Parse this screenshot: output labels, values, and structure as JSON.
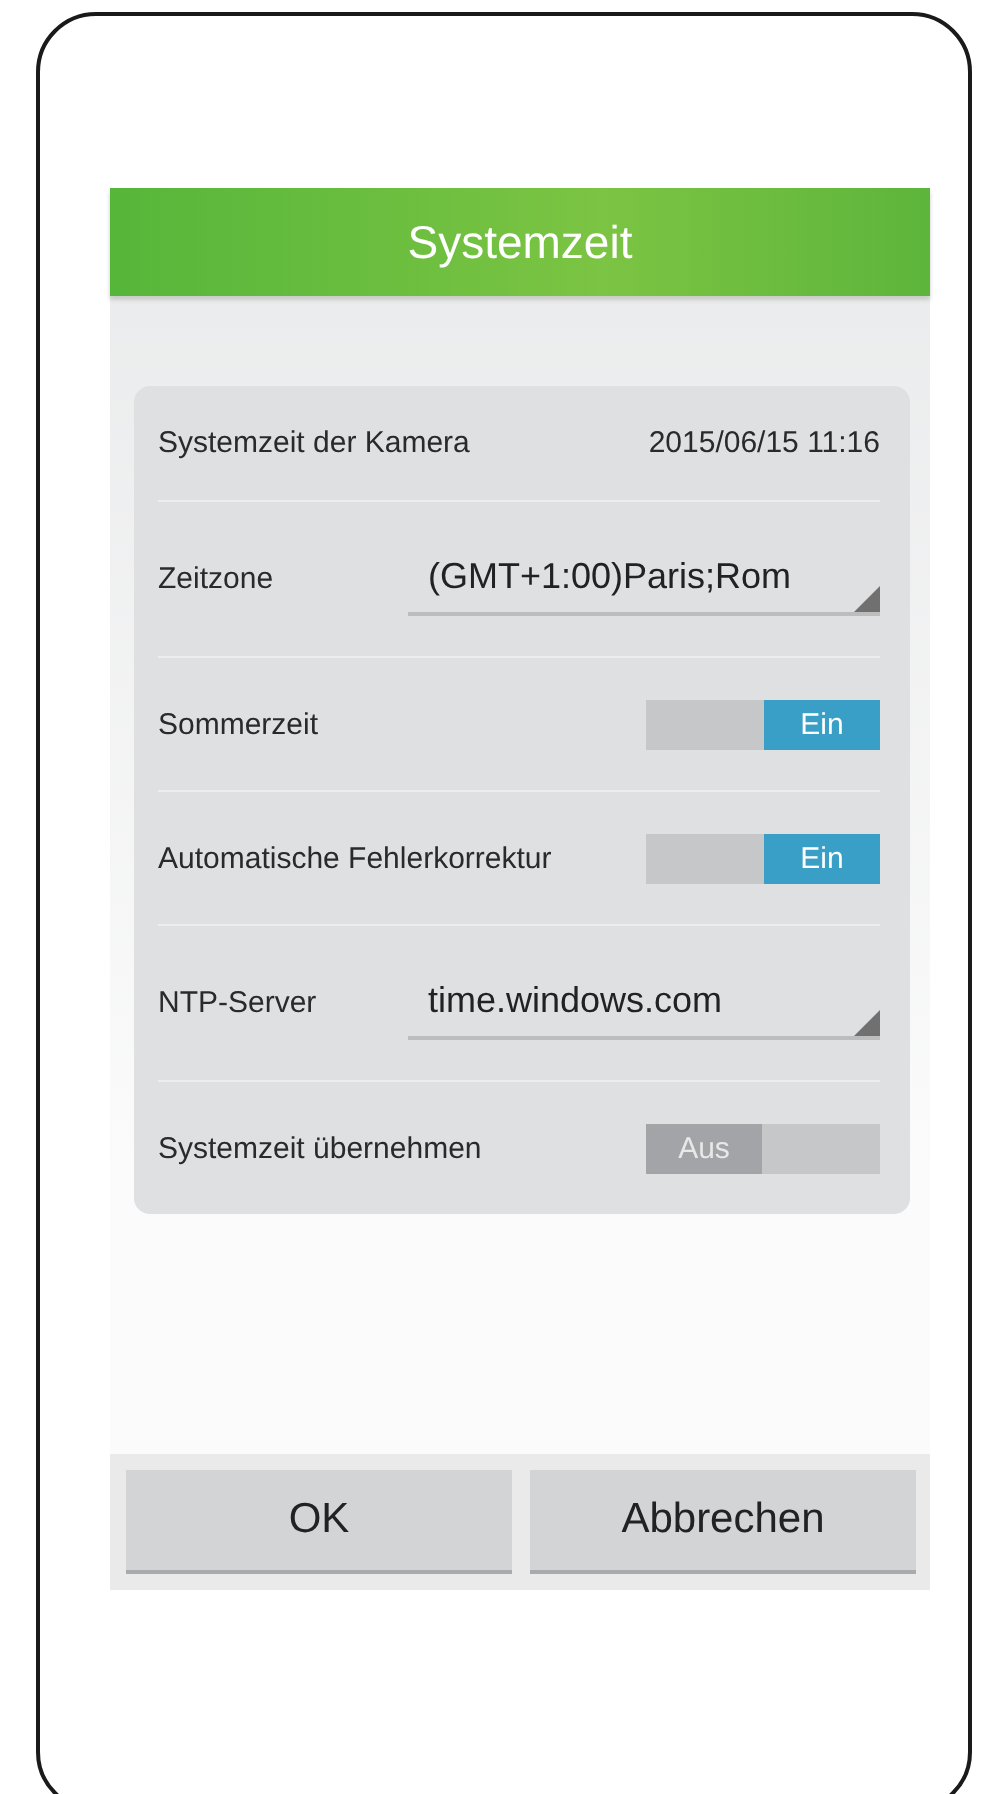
{
  "header": {
    "title": "Systemzeit"
  },
  "settings": [
    {
      "kind": "text",
      "label": "Systemzeit der Kamera",
      "value": "2015/06/15 11:16"
    },
    {
      "kind": "dropdown",
      "label": "Zeitzone",
      "value": "(GMT+1:00)Paris;Rom"
    },
    {
      "kind": "toggle",
      "label": "Sommerzeit",
      "value": "Ein",
      "on": true
    },
    {
      "kind": "toggle",
      "label": "Automatische Fehlerkorrektur",
      "value": "Ein",
      "on": true
    },
    {
      "kind": "dropdown",
      "label": "NTP-Server",
      "value": "time.windows.com"
    },
    {
      "kind": "toggle",
      "label": "Systemzeit übernehmen",
      "value": "Aus",
      "on": false
    }
  ],
  "buttons": [
    "OK",
    "Abbrechen"
  ]
}
